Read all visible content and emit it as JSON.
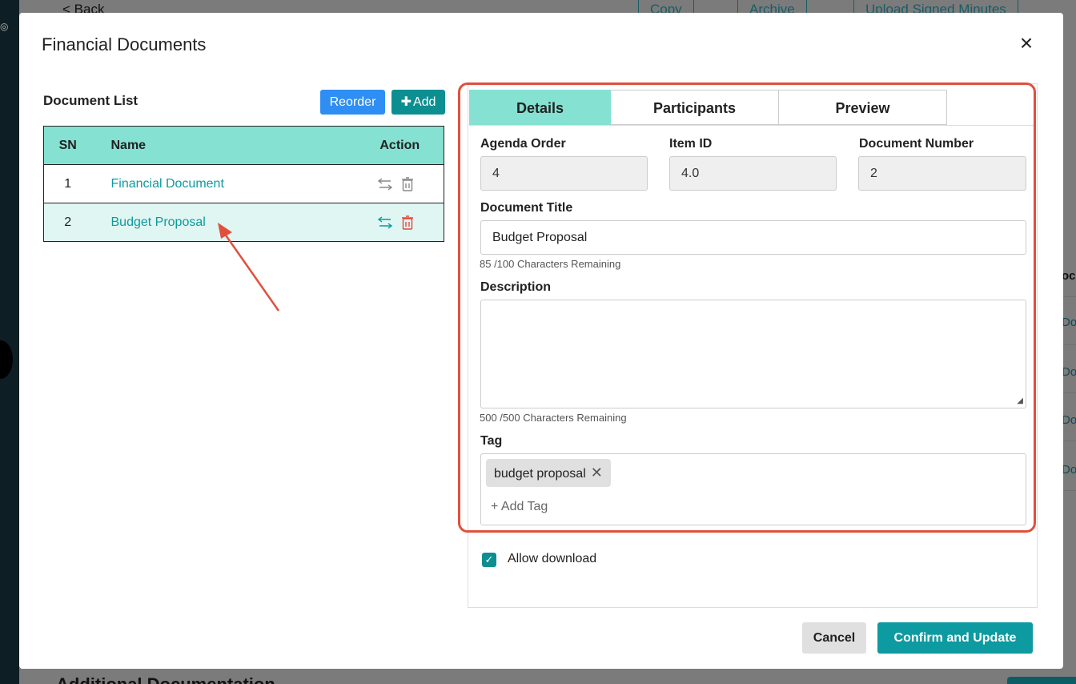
{
  "background": {
    "back_label": "< Back",
    "buttons": [
      "Copy",
      "Archive",
      "Upload Signed Minutes"
    ],
    "section_title": "Additional Documentation",
    "right_header_fragment": "oc",
    "right_link_fragment": "Do"
  },
  "modal": {
    "title": "Financial Documents",
    "close_label": "×"
  },
  "document_list": {
    "title": "Document List",
    "reorder_label": "Reorder",
    "add_label": "Add",
    "columns": [
      "SN",
      "Name",
      "Action"
    ],
    "rows": [
      {
        "sn": "1",
        "name": "Financial Document"
      },
      {
        "sn": "2",
        "name": "Budget Proposal"
      }
    ],
    "selected_row": "2"
  },
  "tabs": [
    "Details",
    "Participants",
    "Preview"
  ],
  "active_tab": "Details",
  "form": {
    "agenda_order_label": "Agenda Order",
    "agenda_order_value": "4",
    "item_id_label": "Item ID",
    "item_id_value": "4.0",
    "document_number_label": "Document Number",
    "document_number_value": "2",
    "document_title_label": "Document Title",
    "document_title_value": "Budget Proposal",
    "title_remaining": "85 /100 Characters Remaining",
    "description_label": "Description",
    "description_value": "",
    "description_remaining": "500 /500 Characters Remaining",
    "tag_label": "Tag",
    "tags": [
      "budget proposal"
    ],
    "add_tag_placeholder": "+ Add Tag",
    "allow_download_label": "Allow download",
    "allow_download_checked": true
  },
  "footer": {
    "cancel_label": "Cancel",
    "confirm_label": "Confirm and Update"
  },
  "colors": {
    "accent_teal": "#0d9aa0",
    "header_mint": "#85e1d2",
    "reorder_blue": "#2f8ef4",
    "highlight_red": "#e0513d",
    "delete_red": "#e8453c"
  }
}
